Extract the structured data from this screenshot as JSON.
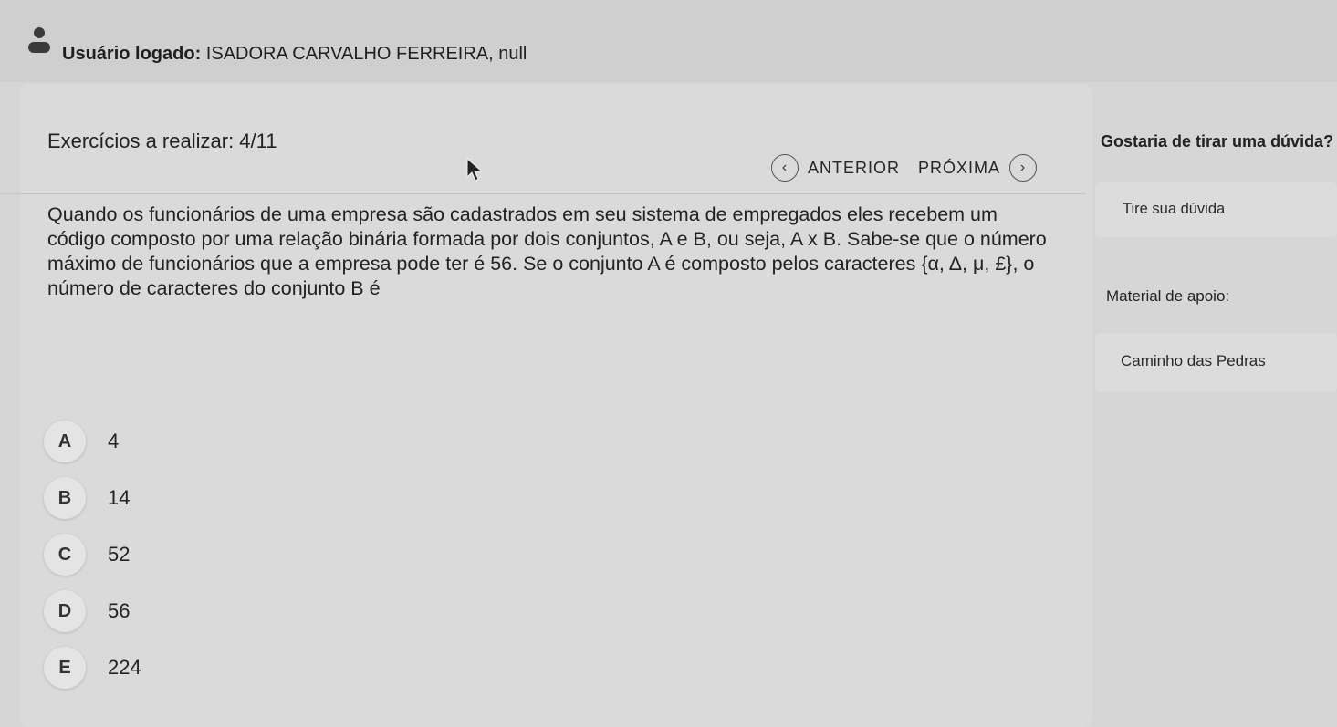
{
  "header": {
    "user_label": "Usuário logado:",
    "user_name": "ISADORA CARVALHO FERREIRA, null",
    "icon": "user-icon"
  },
  "exercise": {
    "counter_label": "Exercícios a realizar: 4/11",
    "nav": {
      "prev_label": "ANTERIOR",
      "next_label": "PRÓXIMA",
      "prev_icon": "‹",
      "next_icon": "›"
    },
    "question_text": "Quando os funcionários de uma empresa são cadastrados em seu sistema de empregados eles recebem um código composto por uma relação binária formada por dois conjuntos, A e B, ou seja, A x B. Sabe-se que o número máximo de funcionários que a empresa pode ter é 56. Se o conjunto A é composto pelos caracteres {α, Δ, μ, £}, o número de caracteres do conjunto B é",
    "answers": [
      {
        "letter": "A",
        "value": "4"
      },
      {
        "letter": "B",
        "value": "14"
      },
      {
        "letter": "C",
        "value": "52"
      },
      {
        "letter": "D",
        "value": "56"
      },
      {
        "letter": "E",
        "value": "224"
      }
    ]
  },
  "sidebar": {
    "question_title": "Gostaria de tirar uma dúvida?",
    "ask_link": "Tire sua dúvida",
    "material_title": "Material de apoio:",
    "material_link": "Caminho das Pedras"
  }
}
